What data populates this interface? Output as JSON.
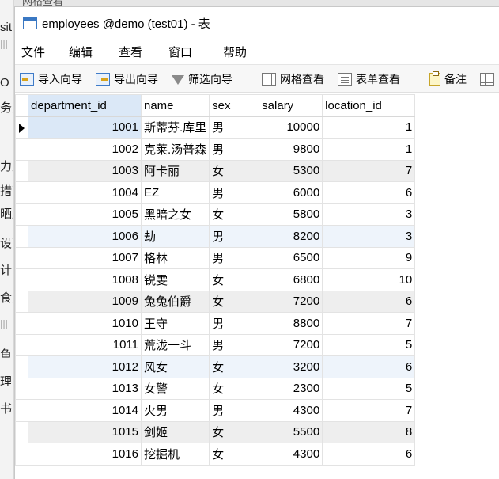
{
  "background": {
    "left_fragments": [
      "sit",
      "lll",
      "O",
      "务主",
      "力主",
      "措丁",
      "晒肩",
      "设丁",
      "计师",
      "食主",
      "lll",
      "鱼",
      "理",
      "书"
    ],
    "top_fragment": "网格查看"
  },
  "window": {
    "title": "employees @demo (test01) - 表"
  },
  "menu": [
    "文件",
    "编辑",
    "查看",
    "窗口",
    "帮助"
  ],
  "toolbar": {
    "import": "导入向导",
    "export": "导出向导",
    "filter": "筛选向导",
    "grid_view": "网格查看",
    "form_view": "表单查看",
    "note": "备注"
  },
  "table": {
    "columns": [
      "department_id",
      "name",
      "sex",
      "salary",
      "location_id"
    ],
    "rows": [
      [
        "1001",
        "斯蒂芬.库里",
        "男",
        "10000",
        "1"
      ],
      [
        "1002",
        "克莱.汤普森",
        "男",
        "9800",
        "1"
      ],
      [
        "1003",
        "阿卡丽",
        "女",
        "5300",
        "7"
      ],
      [
        "1004",
        "EZ",
        "男",
        "6000",
        "6"
      ],
      [
        "1005",
        "黑暗之女",
        "女",
        "5800",
        "3"
      ],
      [
        "1006",
        "劫",
        "男",
        "8200",
        "3"
      ],
      [
        "1007",
        "格林",
        "男",
        "6500",
        "9"
      ],
      [
        "1008",
        "锐雯",
        "女",
        "6800",
        "10"
      ],
      [
        "1009",
        "兔兔伯爵",
        "女",
        "7200",
        "6"
      ],
      [
        "1010",
        "王守",
        "男",
        "8800",
        "7"
      ],
      [
        "1011",
        "荒泷一斗",
        "男",
        "7200",
        "5"
      ],
      [
        "1012",
        "风女",
        "女",
        "3200",
        "6"
      ],
      [
        "1013",
        "女警",
        "女",
        "2300",
        "5"
      ],
      [
        "1014",
        "火男",
        "男",
        "4300",
        "7"
      ],
      [
        "1015",
        "剑姬",
        "女",
        "5500",
        "8"
      ],
      [
        "1016",
        "挖掘机",
        "女",
        "4300",
        "6"
      ]
    ],
    "row_styles": [
      "white",
      "white",
      "shaded",
      "white",
      "white",
      "blue",
      "white",
      "white",
      "shaded",
      "white",
      "white",
      "blue",
      "white",
      "white",
      "shaded",
      "white"
    ]
  },
  "colors": {
    "selection": "#dbe8f7",
    "shaded_row": "#eeeeee",
    "blue_row": "#eef4fb"
  }
}
